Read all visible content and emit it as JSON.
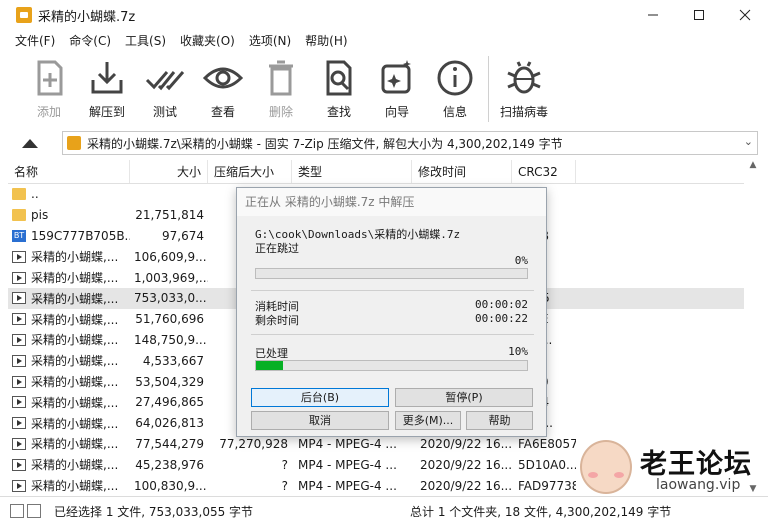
{
  "window": {
    "title": "采精的小蝴蝶.7z"
  },
  "menu": [
    "文件(F)",
    "命令(C)",
    "工具(S)",
    "收藏夹(O)",
    "选项(N)",
    "帮助(H)"
  ],
  "toolbar": [
    {
      "label": "添加",
      "icon": "add-archive-icon",
      "disabled": true
    },
    {
      "label": "解压到",
      "icon": "extract-icon",
      "disabled": false
    },
    {
      "label": "测试",
      "icon": "test-check-icon",
      "disabled": false
    },
    {
      "label": "查看",
      "icon": "view-eye-icon",
      "disabled": false
    },
    {
      "label": "删除",
      "icon": "delete-trash-icon",
      "disabled": true
    },
    {
      "label": "查找",
      "icon": "find-icon",
      "disabled": false
    },
    {
      "label": "向导",
      "icon": "wizard-icon",
      "disabled": false
    },
    {
      "label": "信息",
      "icon": "info-icon",
      "disabled": false
    },
    {
      "label": "扫描病毒",
      "icon": "virus-scan-icon",
      "disabled": false
    }
  ],
  "address": {
    "text": "采精的小蝴蝶.7z\\采精的小蝴蝶 - 固实 7-Zip 压缩文件, 解包大小为 4,300,202,149 字节"
  },
  "columns": [
    "名称",
    "大小",
    "压缩后大小",
    "类型",
    "修改时间",
    "CRC32"
  ],
  "rows": [
    {
      "icon": "folder",
      "name": "..",
      "size": "",
      "psize": "",
      "type": "",
      "date": "",
      "crc": ""
    },
    {
      "icon": "folder",
      "name": "pis",
      "size": "21,751,814",
      "psize": "",
      "type": "",
      "date": "",
      "crc": ""
    },
    {
      "icon": "bt",
      "name": "159C777B705B...",
      "size": "97,674",
      "psize": "2,03",
      "type": "",
      "date": "",
      "crc": "FB9B"
    },
    {
      "icon": "video",
      "name": "采精的小蝴蝶,...",
      "size": "106,609,9...",
      "psize": "",
      "type": "",
      "date": "",
      "crc": "F472"
    },
    {
      "icon": "video",
      "name": "采精的小蝴蝶,...",
      "size": "1,003,969,...",
      "psize": "2,09",
      "type": "",
      "date": "",
      "crc": "B2..."
    },
    {
      "icon": "video",
      "name": "采精的小蝴蝶,...",
      "size": "753,033,0...",
      "psize": "",
      "type": "",
      "date": "",
      "crc": "A8B5",
      "selected": true
    },
    {
      "icon": "video",
      "name": "采精的小蝴蝶,...",
      "size": "51,760,696",
      "psize": "",
      "type": "",
      "date": "",
      "crc": "093E"
    },
    {
      "icon": "video",
      "name": "采精的小蝴蝶,...",
      "size": "148,750,9...",
      "psize": "",
      "type": "",
      "date": "",
      "crc": "319..."
    },
    {
      "icon": "video",
      "name": "采精的小蝴蝶,...",
      "size": "4,533,667",
      "psize": "",
      "type": "",
      "date": "",
      "crc": "BB..."
    },
    {
      "icon": "video",
      "name": "采精的小蝴蝶,...",
      "size": "53,504,329",
      "psize": "",
      "type": "",
      "date": "",
      "crc": "8450"
    },
    {
      "icon": "video",
      "name": "采精的小蝴蝶,...",
      "size": "27,496,865",
      "psize": "",
      "type": "",
      "date": "",
      "crc": "0B54"
    },
    {
      "icon": "video",
      "name": "采精的小蝴蝶,...",
      "size": "64,026,813",
      "psize": "",
      "type": "",
      "date": "",
      "crc": "6B0..."
    },
    {
      "icon": "video",
      "name": "采精的小蝴蝶,...",
      "size": "77,544,279",
      "psize": "77,270,928",
      "type": "MP4 - MPEG-4 ...",
      "date": "2020/9/22 16...",
      "crc": "FA6E8057"
    },
    {
      "icon": "video",
      "name": "采精的小蝴蝶,...",
      "size": "45,238,976",
      "psize": "?",
      "type": "MP4 - MPEG-4 ...",
      "date": "2020/9/22 16...",
      "crc": "5D10A0..."
    },
    {
      "icon": "video",
      "name": "采精的小蝴蝶,...",
      "size": "100,830,9...",
      "psize": "?",
      "type": "MP4 - MPEG-4 ...",
      "date": "2020/9/22 16...",
      "crc": "FAD97738"
    }
  ],
  "status": {
    "left": "已经选择 1 文件, 753,033,055 字节",
    "right": "总计 1 个文件夹, 18 文件, 4,300,202,149 字节"
  },
  "dialog": {
    "title": "正在从 采精的小蝴蝶.7z 中解压",
    "path": "G:\\cook\\Downloads\\采精的小蝴蝶.7z",
    "skip_label": "正在跳过",
    "skip_percent": "0%",
    "skip_progress": 0,
    "elapsed_label": "消耗时间",
    "elapsed_value": "00:00:02",
    "remaining_label": "剩余时间",
    "remaining_value": "00:00:22",
    "processed_label": "已处理",
    "processed_percent": "10%",
    "processed_progress": 0.1,
    "buttons": {
      "background": "后台(B)",
      "pause": "暂停(P)",
      "cancel": "取消",
      "more": "更多(M)...",
      "help": "帮助"
    }
  },
  "watermark": {
    "text": "老王论坛",
    "sub": "laowang.vip"
  },
  "colors": {
    "progress": "#06b025",
    "folder": "#f2c24f",
    "app": "#e8a21a"
  }
}
